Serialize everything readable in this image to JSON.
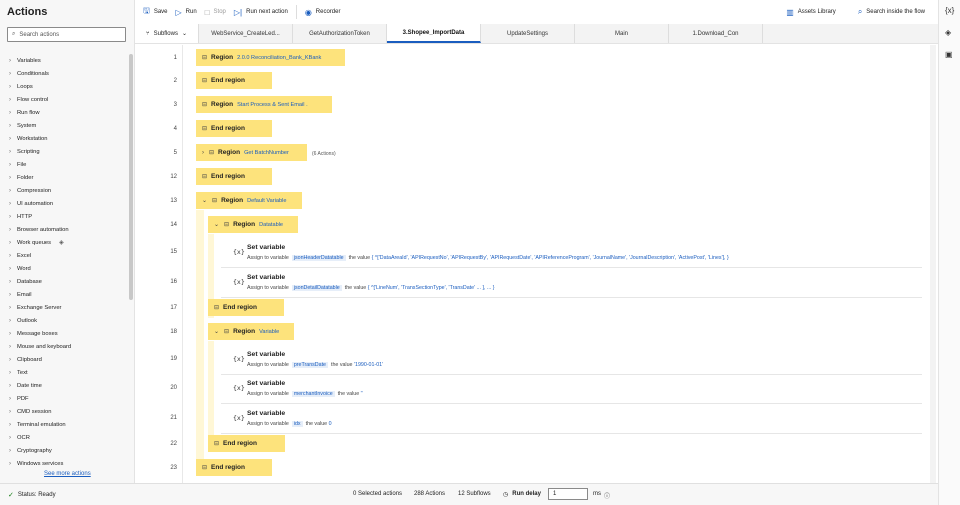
{
  "left_panel": {
    "title": "Actions",
    "search_placeholder": "Search actions",
    "categories": [
      "Variables",
      "Conditionals",
      "Loops",
      "Flow control",
      "Run flow",
      "System",
      "Workstation",
      "Scripting",
      "File",
      "Folder",
      "Compression",
      "UI automation",
      "HTTP",
      "Browser automation",
      "Work queues",
      "Excel",
      "Word",
      "Database",
      "Email",
      "Exchange Server",
      "Outlook",
      "Message boxes",
      "Mouse and keyboard",
      "Clipboard",
      "Text",
      "Date time",
      "PDF",
      "CMD session",
      "Terminal emulation",
      "OCR",
      "Cryptography",
      "Windows services"
    ],
    "see_more": "See more actions"
  },
  "toolbar": {
    "save": "Save",
    "run": "Run",
    "stop": "Stop",
    "run_next": "Run next action",
    "recorder": "Recorder",
    "assets": "Assets Library",
    "search": "Search inside the flow"
  },
  "tabs": {
    "subflows": "Subflows",
    "items": [
      "WebService_CreateLed...",
      "GetAuthorizationToken",
      "3.Shopee_ImportData",
      "UpdateSettings",
      "Main",
      "1.Download_Con"
    ],
    "active_index": 2
  },
  "rows": {
    "r1": {
      "ln": "1",
      "kw": "Region",
      "name": "2.0.0 Reconciliation_Bank_KBank"
    },
    "r2": {
      "ln": "2",
      "kw": "End region"
    },
    "r3": {
      "ln": "3",
      "kw": "Region",
      "name": "Start Process & Sent Email ."
    },
    "r4": {
      "ln": "4",
      "kw": "End region"
    },
    "r5": {
      "ln": "5",
      "kw": "Region",
      "name": "Get BatchNumber",
      "note": "(6 Actions)"
    },
    "r12": {
      "ln": "12",
      "kw": "End region"
    },
    "r13": {
      "ln": "13",
      "kw": "Region",
      "name": "Default Variable"
    },
    "r14": {
      "ln": "14",
      "kw": "Region",
      "name": "Datatable"
    },
    "r15": {
      "ln": "15",
      "title": "Set variable",
      "assign": "Assign to variable",
      "var": "jsonHeaderDatatable",
      "value_label": "the value",
      "value": "{ ^['DataAreaId', 'APIRequestNo', 'APIRequestBy', 'APIRequestDate', 'APIReferenceProgram', 'JournalName', 'JournalDescription', 'ActivePost', 'Lines'], }"
    },
    "r16": {
      "ln": "16",
      "title": "Set variable",
      "assign": "Assign to variable",
      "var": "jsonDetailDatatable",
      "value_label": "the value",
      "value": "{ ^['LineNum', 'TransSectionType', 'TransDate' ... ], ... }"
    },
    "r17": {
      "ln": "17",
      "kw": "End region"
    },
    "r18": {
      "ln": "18",
      "kw": "Region",
      "name": "Variable"
    },
    "r19": {
      "ln": "19",
      "title": "Set variable",
      "assign": "Assign to variable",
      "var": "preTransDate",
      "value_label": "the value",
      "value": "'1990-01-01'"
    },
    "r20": {
      "ln": "20",
      "title": "Set variable",
      "assign": "Assign to variable",
      "var": "merchantInvoice",
      "value_label": "the value",
      "value": "''"
    },
    "r21": {
      "ln": "21",
      "title": "Set variable",
      "assign": "Assign to variable",
      "var": "idx",
      "value_label": "the value",
      "value": "0"
    },
    "r22": {
      "ln": "22",
      "kw": "End region"
    },
    "r23": {
      "ln": "23",
      "kw": "End region"
    }
  },
  "status": {
    "ready": "Status: Ready",
    "selected": "0 Selected actions",
    "actions": "288 Actions",
    "subflows": "12 Subflows",
    "run_delay": "Run delay",
    "delay_value": "1",
    "unit": "ms"
  }
}
